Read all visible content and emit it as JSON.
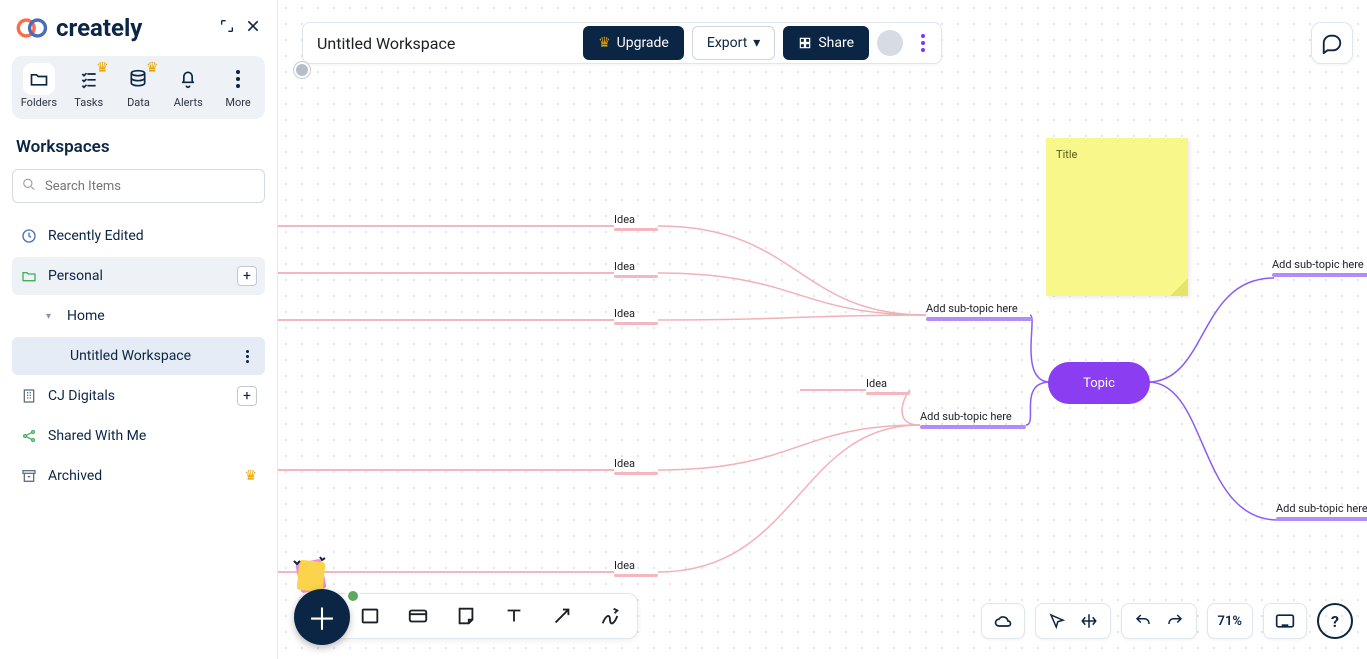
{
  "brand": "creately",
  "topTiles": {
    "folders": "Folders",
    "tasks": "Tasks",
    "data": "Data",
    "alerts": "Alerts",
    "more": "More"
  },
  "wsHeading": "Workspaces",
  "search": {
    "placeholder": "Search Items"
  },
  "nav": {
    "recent": "Recently Edited",
    "personal": "Personal",
    "home": "Home",
    "doc": "Untitled Workspace",
    "cj": "CJ Digitals",
    "shared": "Shared With Me",
    "archived": "Archived"
  },
  "topbar": {
    "title": "Untitled Workspace",
    "upgrade": "Upgrade",
    "export": "Export",
    "share": "Share"
  },
  "mindmap": {
    "topic": "Topic",
    "sub": "Add sub-topic here",
    "idea": "Idea",
    "sticky": "Title"
  },
  "footer": {
    "zoom": "71%"
  }
}
